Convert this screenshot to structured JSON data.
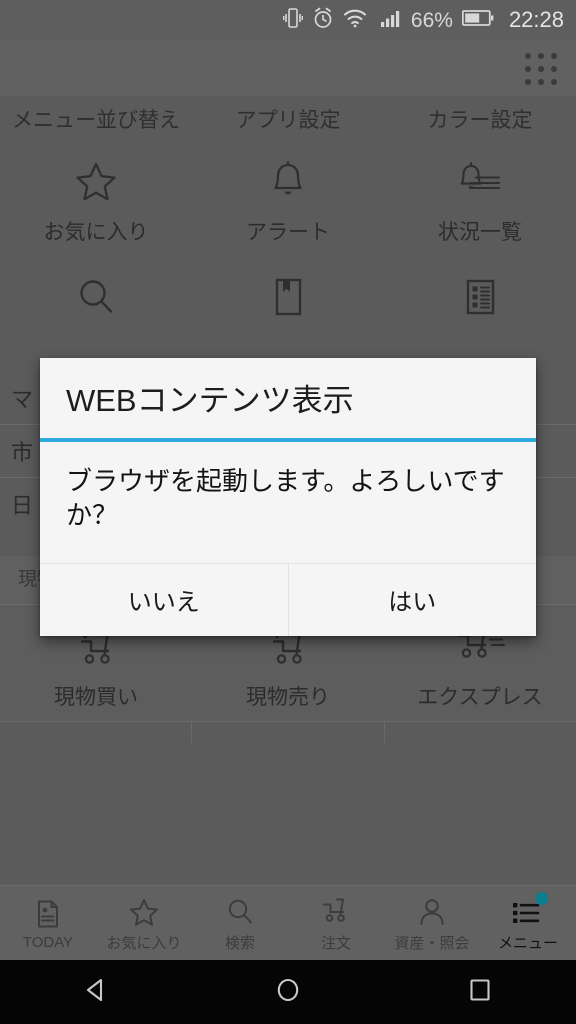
{
  "status_bar": {
    "icons": [
      "vibrate-icon",
      "alarm-icon",
      "wifi-icon",
      "signal-icon",
      "battery-icon"
    ],
    "battery_percent": "66%",
    "time": "22:28"
  },
  "app_header": {
    "grid_icon": "grid-dots-icon"
  },
  "menu": {
    "row1_labels": [
      "メニュー並び替え",
      "アプリ設定",
      "カラー設定"
    ],
    "row2": [
      {
        "icon": "star-icon",
        "label": "お気に入り"
      },
      {
        "icon": "bell-icon",
        "label": "アラート"
      },
      {
        "icon": "bell-list-icon",
        "label": "状況一覧"
      }
    ],
    "row3": [
      {
        "icon": "search-icon",
        "label": ""
      },
      {
        "icon": "book-icon",
        "label": ""
      },
      {
        "icon": "list-document-icon",
        "label": ""
      }
    ],
    "obscured_labels": [
      "マ",
      "市",
      "日"
    ],
    "section_title": "現物取引",
    "row4": [
      {
        "icon": "cart-buy-icon",
        "label": "現物買い"
      },
      {
        "icon": "cart-sell-icon",
        "label": "現物売り"
      },
      {
        "icon": "cart-express-icon",
        "label": "エクスプレス"
      }
    ]
  },
  "dialog": {
    "title": "WEBコンテンツ表示",
    "message": "ブラウザを起動します。よろしいですか？",
    "accent_color": "#2fa8e0",
    "negative_button": "いいえ",
    "positive_button": "はい"
  },
  "tabbar": {
    "items": [
      {
        "icon": "document-icon",
        "label": "TODAY",
        "active": false
      },
      {
        "icon": "star-icon",
        "label": "お気に入り",
        "active": false
      },
      {
        "icon": "search-icon",
        "label": "検索",
        "active": false
      },
      {
        "icon": "cart-icon",
        "label": "注文",
        "active": false
      },
      {
        "icon": "person-icon",
        "label": "資産・照会",
        "active": false
      },
      {
        "icon": "list-menu-icon",
        "label": "メニュー",
        "active": true
      }
    ],
    "badge_color": "#0b7e8e"
  },
  "navbar": {
    "back": "back-triangle-icon",
    "home": "home-circle-icon",
    "recents": "recents-square-icon"
  }
}
